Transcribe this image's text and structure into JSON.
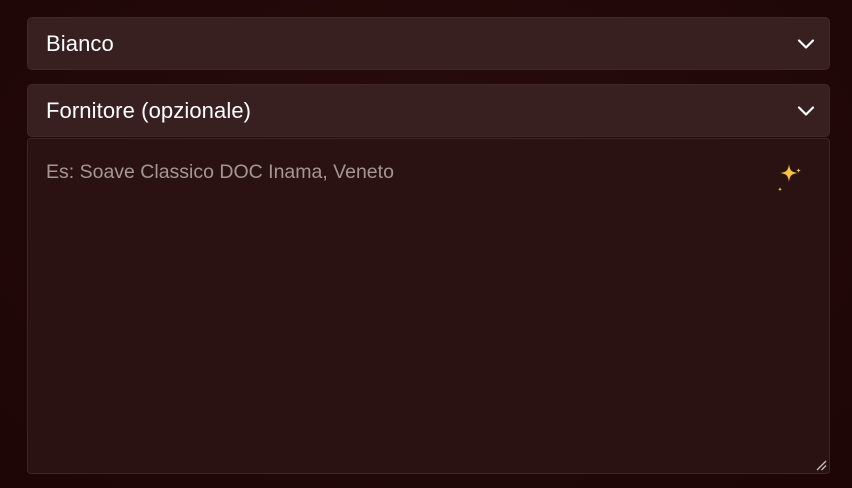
{
  "form": {
    "wine_type_select": {
      "value": "Bianco",
      "icon": "chevron-down-icon"
    },
    "supplier_select": {
      "value": "Fornitore (opzionale)",
      "icon": "chevron-down-icon"
    },
    "description_textarea": {
      "value": "",
      "placeholder": "Es: Soave Classico DOC Inama, Veneto",
      "action_icon": "sparkles-icon"
    }
  },
  "colors": {
    "background": "#220707",
    "field_background": "#382020",
    "textarea_background": "#2b1212",
    "text": "#ffffff",
    "placeholder": "#a49696",
    "sparkle": "#f5c542"
  }
}
